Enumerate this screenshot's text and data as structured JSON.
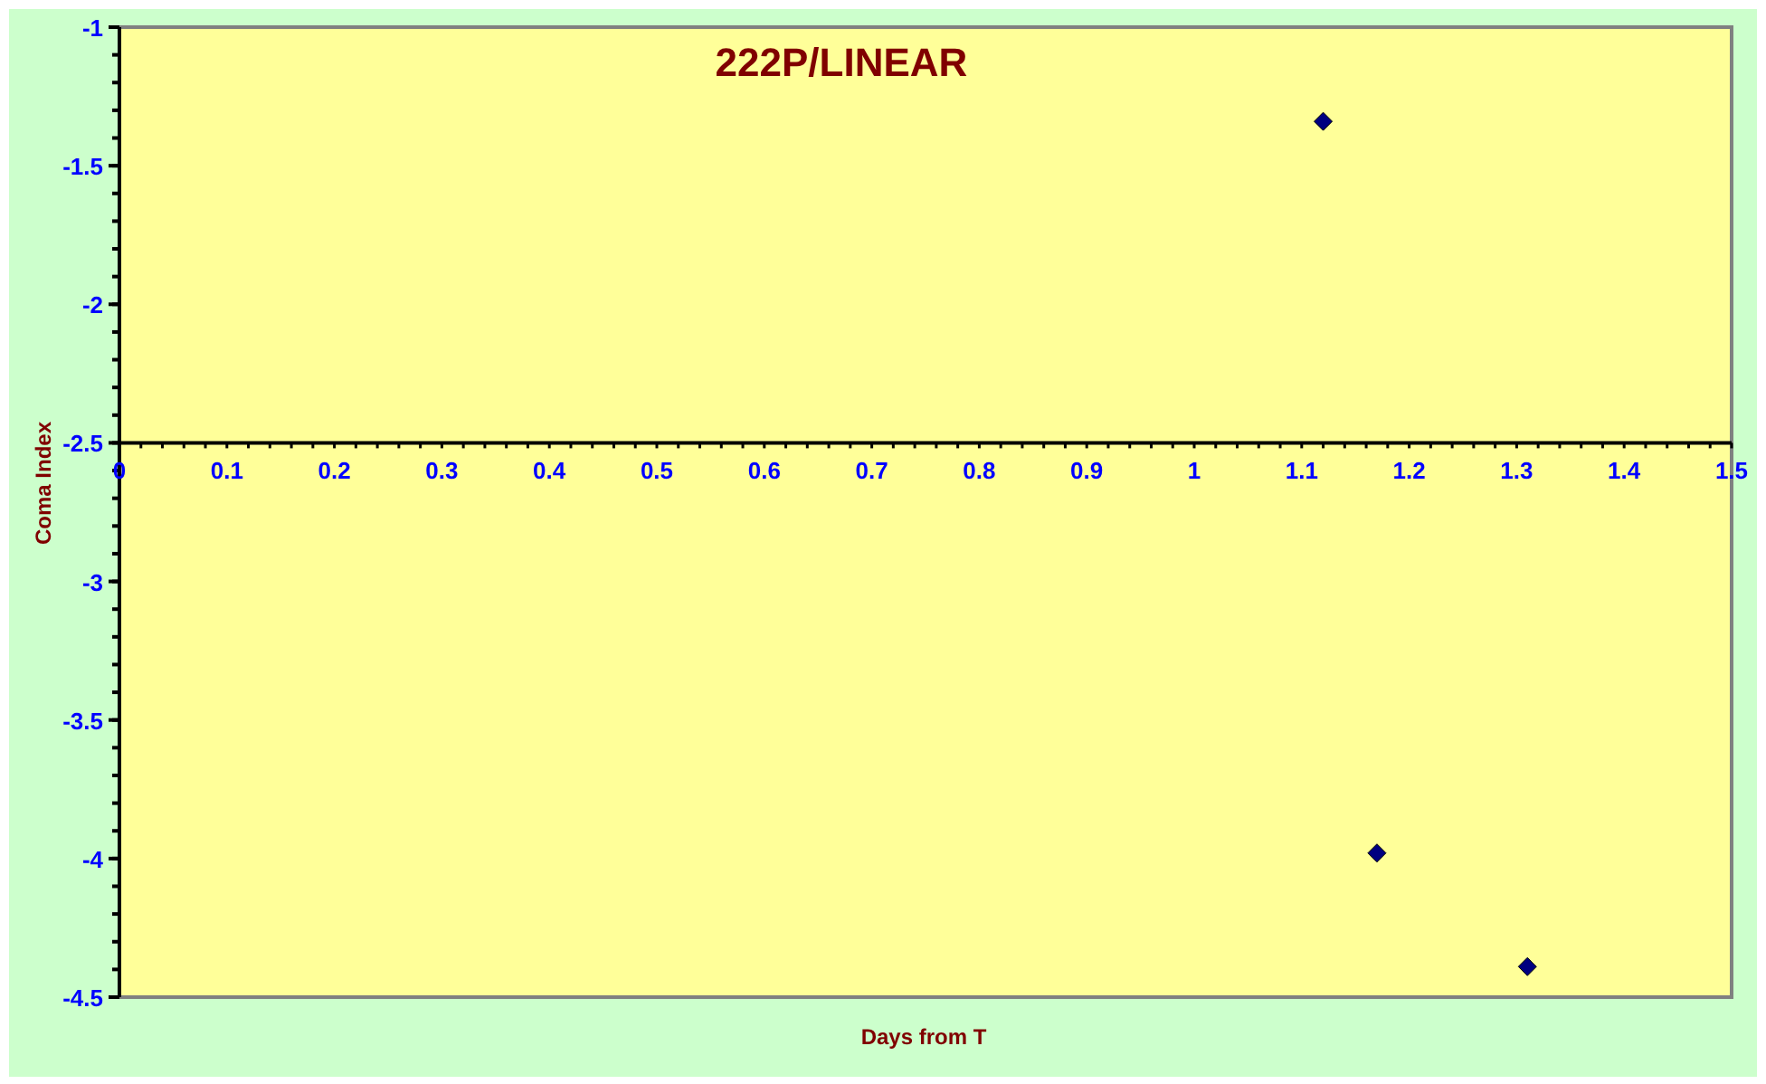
{
  "chart_data": {
    "type": "scatter",
    "title": "222P/LINEAR",
    "xlabel": "Days from T",
    "ylabel": "Coma Index",
    "x": [
      1.12,
      1.17,
      1.31
    ],
    "series": [
      {
        "color": "#000080",
        "values": [
          -1.34,
          -3.98,
          -4.39
        ]
      }
    ],
    "xlim": [
      0,
      1.5
    ],
    "ylim": [
      -4.5,
      -1
    ],
    "xticks": [
      0,
      0.1,
      0.2,
      0.3,
      0.4,
      0.5,
      0.6,
      0.7,
      0.8,
      0.9,
      1,
      1.1,
      1.2,
      1.3,
      1.4,
      1.5
    ],
    "yticks": [
      -1,
      -1.5,
      -2,
      -2.5,
      -3,
      -3.5,
      -4,
      -4.5
    ]
  }
}
